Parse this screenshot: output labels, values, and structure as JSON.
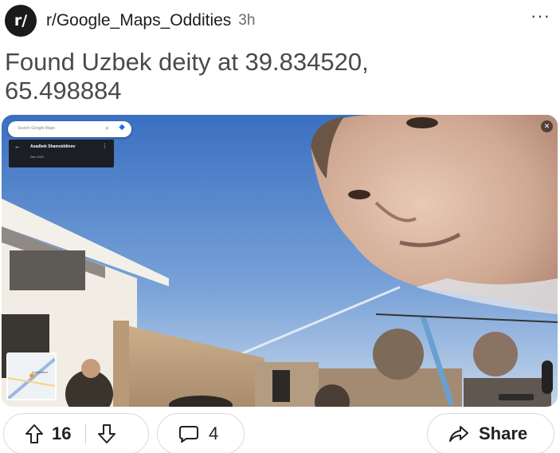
{
  "header": {
    "sub_icon_text": "r/",
    "subreddit": "r/Google_Maps_Oddities",
    "time": "3h",
    "more_icon": "more-horizontal-icon"
  },
  "post": {
    "title": "Found Uzbek deity at 39.834520, 65.498884"
  },
  "streetview": {
    "search_placeholder": "Search Google Maps",
    "author": "Asadbek Shamsiddinov",
    "date": "Dec 2022",
    "minimap_label": "Uzbekistan",
    "close_icon": "close-icon"
  },
  "actions": {
    "score": "16",
    "comments": "4",
    "share_label": "Share"
  },
  "colors": {
    "sky_top": "#3f74c4",
    "sky_bottom": "#b7cde6",
    "wall": "#c8a984",
    "text_primary": "#1a1a1b",
    "title_gray": "#4a4a4a"
  }
}
